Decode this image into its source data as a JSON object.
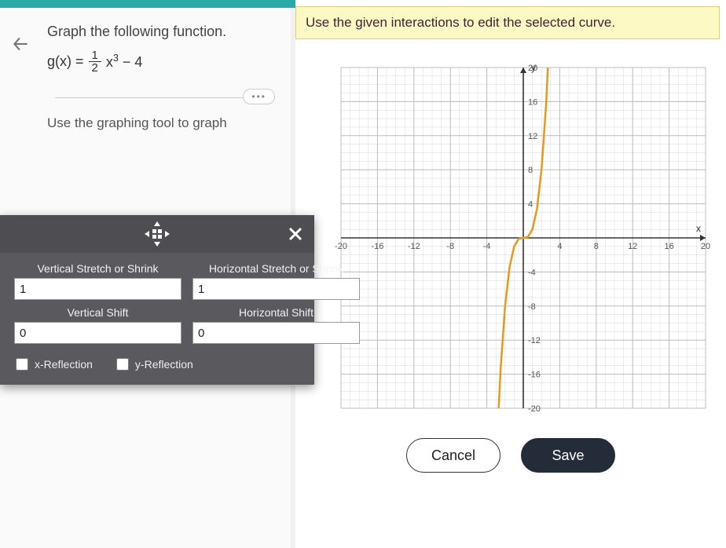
{
  "problem": {
    "instruction": "Graph the following function.",
    "function_prefix": "g(x) =",
    "frac_num": "1",
    "frac_den": "2",
    "x_part": "x",
    "exp": "3",
    "tail": " − 4",
    "tool_instruction": "Use the graphing tool to graph"
  },
  "transform": {
    "v_stretch_label": "Vertical Stretch or Shrink",
    "h_stretch_label": "Horizontal Stretch or Shrink",
    "v_shift_label": "Vertical Shift",
    "h_shift_label": "Horizontal Shift",
    "x_reflect_label": "x-Reflection",
    "y_reflect_label": "y-Reflection",
    "v_stretch_value": "1",
    "h_stretch_value": "1",
    "v_shift_value": "0",
    "h_shift_value": "0"
  },
  "right": {
    "hint": "Use the given interactions to edit the selected curve.",
    "cancel": "Cancel",
    "save": "Save"
  },
  "ellipsis": "•••",
  "chart_data": {
    "type": "line",
    "xlabel": "x",
    "ylabel": "y",
    "xlim": [
      -20,
      20
    ],
    "ylim": [
      -20,
      20
    ],
    "xticks": [
      -20,
      -16,
      -12,
      -8,
      -4,
      4,
      8,
      12,
      16,
      20
    ],
    "yticks": [
      -20,
      -16,
      -12,
      -8,
      -4,
      4,
      8,
      12,
      16,
      20
    ],
    "series": [
      {
        "name": "x^3",
        "color": "#e59a1f",
        "x": [
          -2.7,
          -2.5,
          -2,
          -1.5,
          -1,
          -0.5,
          0,
          0.5,
          1,
          1.5,
          2,
          2.5,
          2.7
        ],
        "values": [
          -20,
          -15.6,
          -8,
          -3.4,
          -1,
          -0.1,
          0,
          0.1,
          1,
          3.4,
          8,
          15.6,
          20
        ]
      }
    ]
  }
}
